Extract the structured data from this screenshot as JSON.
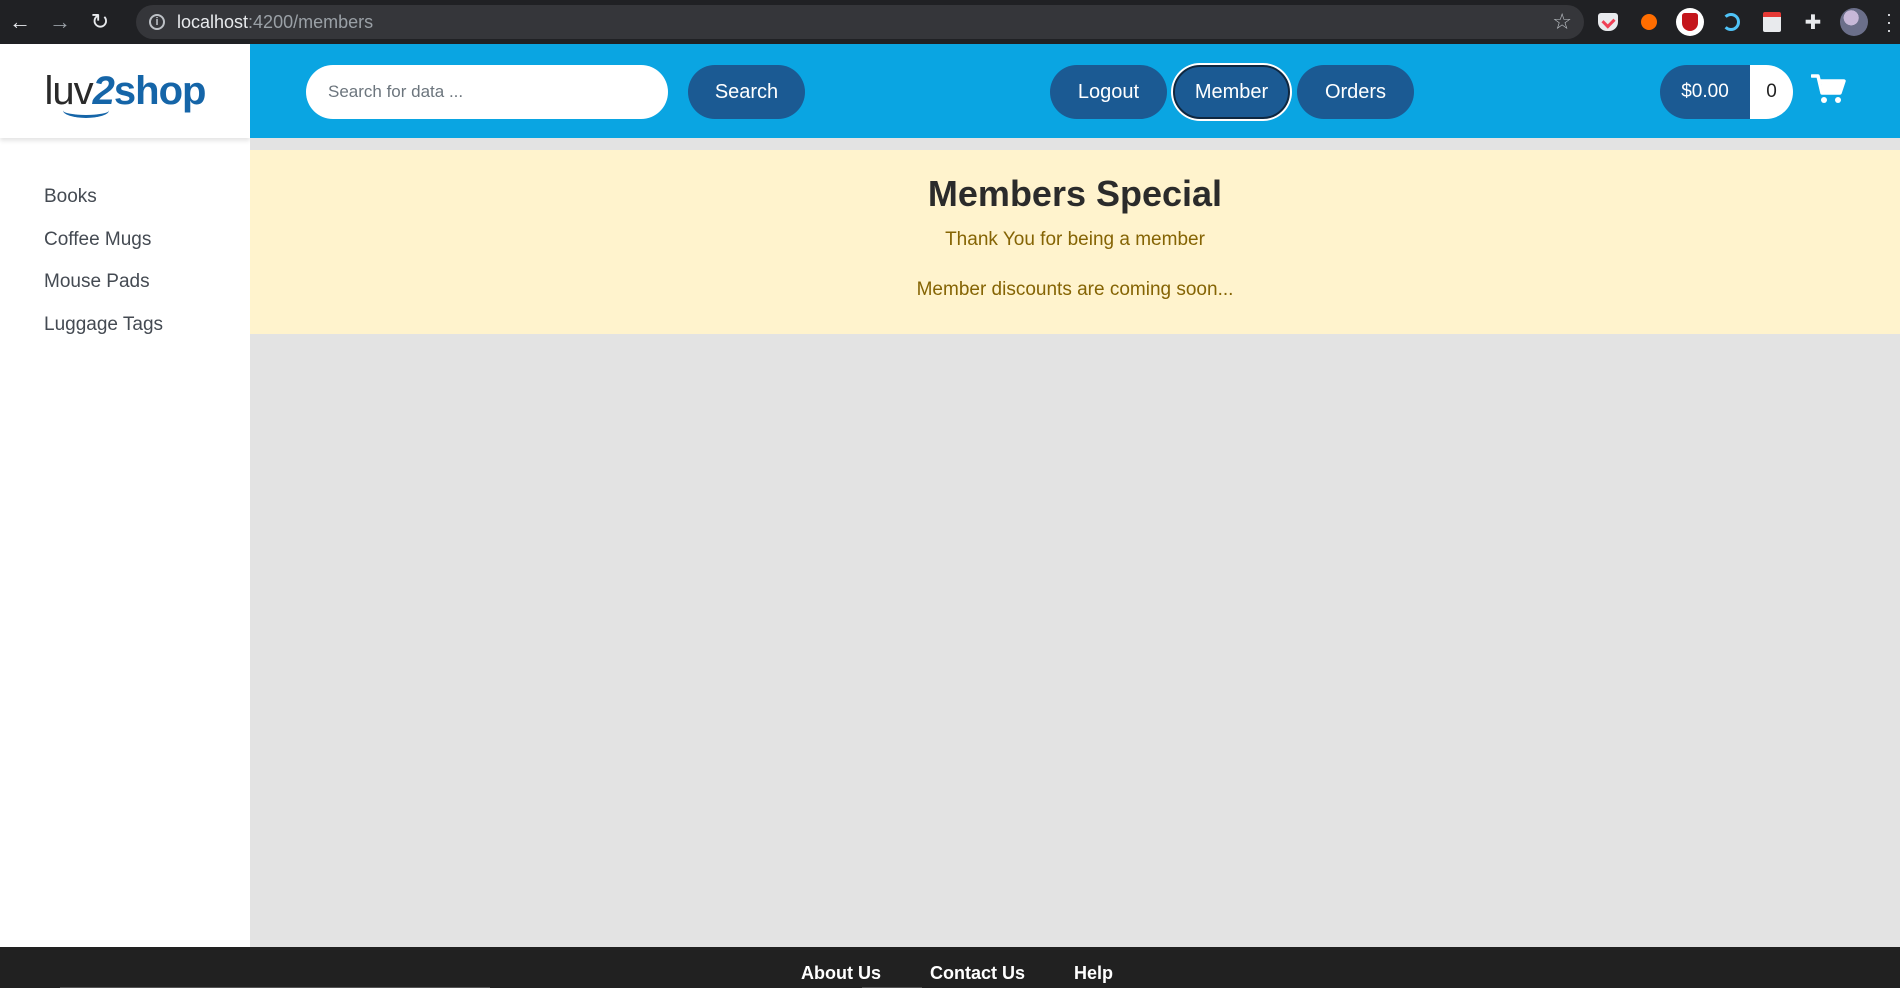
{
  "browser": {
    "url_host": "localhost",
    "url_rest": ":4200/members",
    "nav": {
      "back": "←",
      "forward": "→",
      "reload": "↻"
    }
  },
  "logo": {
    "part1": "luv",
    "part2": "2",
    "part3": "shop"
  },
  "sidebar": {
    "categories": [
      "Books",
      "Coffee Mugs",
      "Mouse Pads",
      "Luggage Tags"
    ]
  },
  "header": {
    "search_placeholder": "Search for data ...",
    "search_label": "Search",
    "logout_label": "Logout",
    "member_label": "Member",
    "orders_label": "Orders",
    "cart_total": "$0.00",
    "cart_quantity": "0"
  },
  "main": {
    "title": "Members Special",
    "line1": "Thank You for being a member",
    "line2": "Member discounts are coming soon..."
  },
  "footer": {
    "links": [
      "About Us",
      "Contact Us",
      "Help"
    ]
  },
  "colors": {
    "header_bg": "#0aa5e2",
    "button_bg": "#1b5a93",
    "banner_bg": "#fff3cd",
    "banner_text": "#856404",
    "main_bg": "#e3e3e3",
    "footer_bg": "#212121"
  },
  "icons": {
    "cart": "shopping-cart-icon",
    "star": "bookmark-star-icon",
    "info": "site-info-icon",
    "puzzle": "extensions-icon"
  }
}
